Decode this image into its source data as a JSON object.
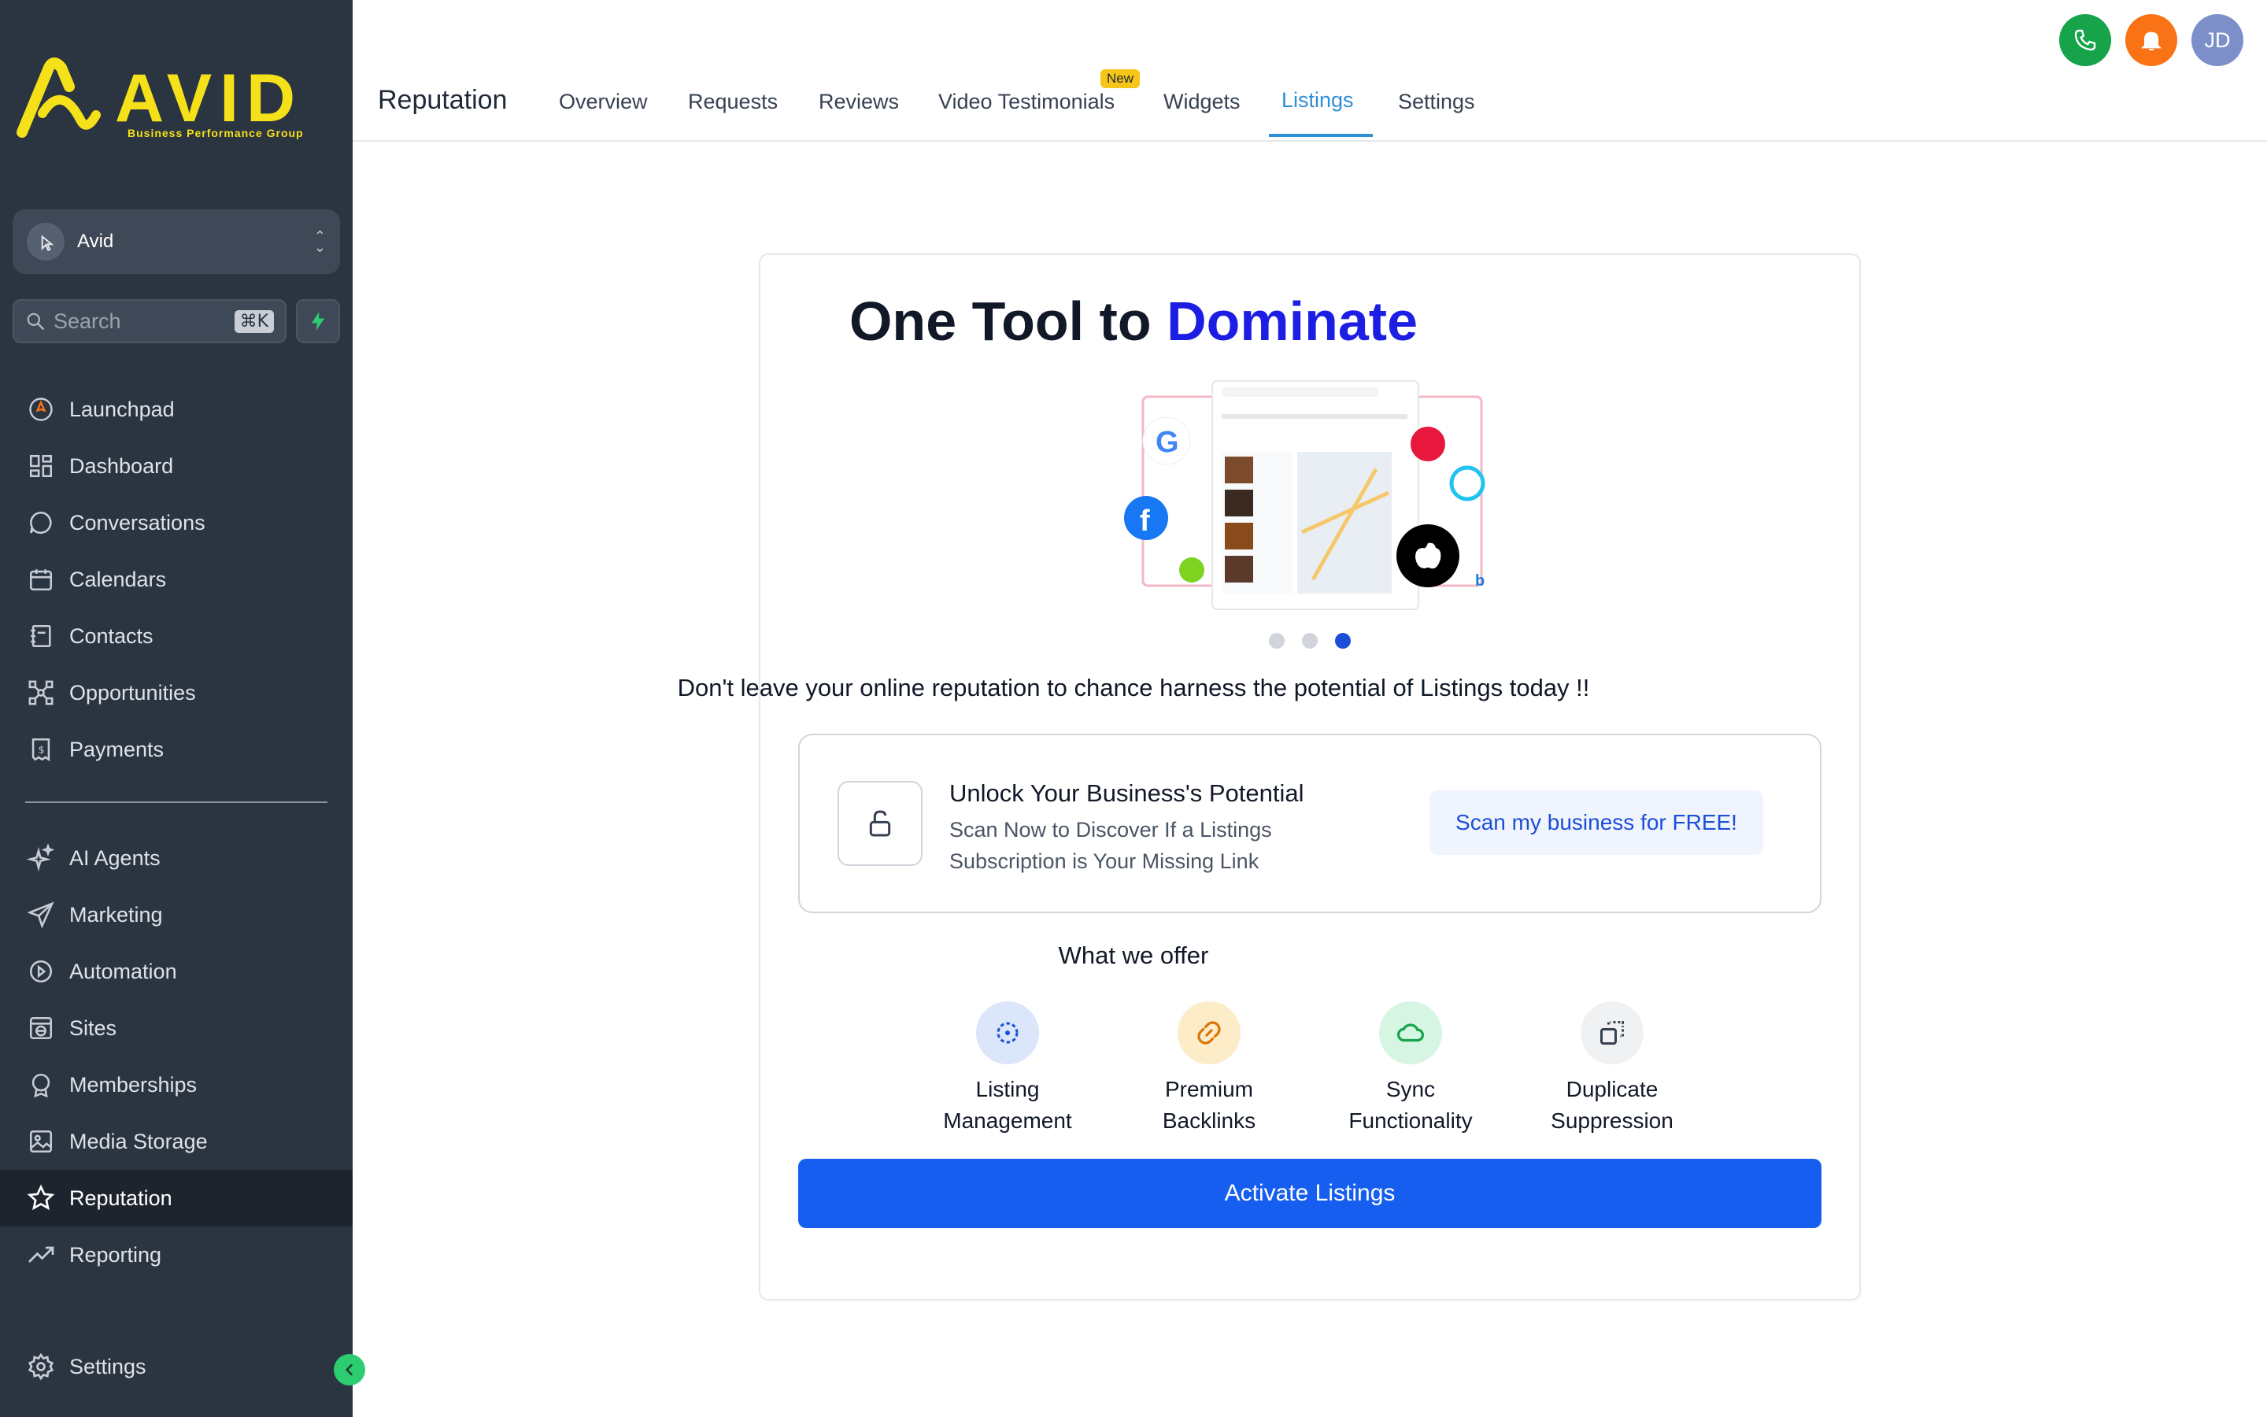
{
  "brand": {
    "name": "AVID",
    "tagline": "Business Performance Group",
    "accent": "#f5e11a"
  },
  "location": {
    "name": "Avid"
  },
  "search": {
    "placeholder": "Search",
    "shortcut": "⌘K"
  },
  "sidebar": {
    "items": [
      {
        "label": "Launchpad",
        "icon": "rocket-icon"
      },
      {
        "label": "Dashboard",
        "icon": "grid-icon"
      },
      {
        "label": "Conversations",
        "icon": "chat-icon"
      },
      {
        "label": "Calendars",
        "icon": "calendar-icon"
      },
      {
        "label": "Contacts",
        "icon": "contacts-icon"
      },
      {
        "label": "Opportunities",
        "icon": "network-icon"
      },
      {
        "label": "Payments",
        "icon": "invoice-icon"
      }
    ],
    "items2": [
      {
        "label": "AI Agents",
        "icon": "sparkle-icon"
      },
      {
        "label": "Marketing",
        "icon": "send-icon"
      },
      {
        "label": "Automation",
        "icon": "automation-icon"
      },
      {
        "label": "Sites",
        "icon": "globe-icon"
      },
      {
        "label": "Memberships",
        "icon": "badge-icon"
      },
      {
        "label": "Media Storage",
        "icon": "image-icon"
      },
      {
        "label": "Reputation",
        "icon": "star-icon",
        "active": true
      },
      {
        "label": "Reporting",
        "icon": "trend-icon"
      }
    ],
    "settings": "Settings"
  },
  "header": {
    "title": "Reputation",
    "tabs": [
      "Overview",
      "Requests",
      "Reviews",
      "Video Testimonials",
      "Widgets",
      "Listings",
      "Settings"
    ],
    "active_tab": "Listings",
    "new_badge": "New",
    "user_initials": "JD"
  },
  "hero": {
    "title_prefix": "One Tool to ",
    "title_accent": "Dominate",
    "subtitle": "Don't leave your online reputation to chance harness the potential of Listings today !!",
    "carousel_active": 3,
    "carousel_count": 3
  },
  "unlock": {
    "title": "Unlock Your Business's Potential",
    "line1": "Scan Now to Discover If a Listings",
    "line2": "Subscription is Your Missing Link",
    "cta": "Scan my business for FREE!"
  },
  "offer": {
    "title": "What we offer",
    "features": [
      {
        "line1": "Listing",
        "line2": "Management",
        "icon": "scan-icon",
        "bg": "#dbe6fb",
        "fg": "#1d4ed8"
      },
      {
        "line1": "Premium",
        "line2": "Backlinks",
        "icon": "link-icon",
        "bg": "#fdecc8",
        "fg": "#d97706"
      },
      {
        "line1": "Sync",
        "line2": "Functionality",
        "icon": "cloud-icon",
        "bg": "#d7f5e3",
        "fg": "#16a34a"
      },
      {
        "line1": "Duplicate",
        "line2": "Suppression",
        "icon": "copy-icon",
        "bg": "#f0f1f3",
        "fg": "#374151"
      }
    ]
  },
  "activate": {
    "label": "Activate Listings"
  }
}
